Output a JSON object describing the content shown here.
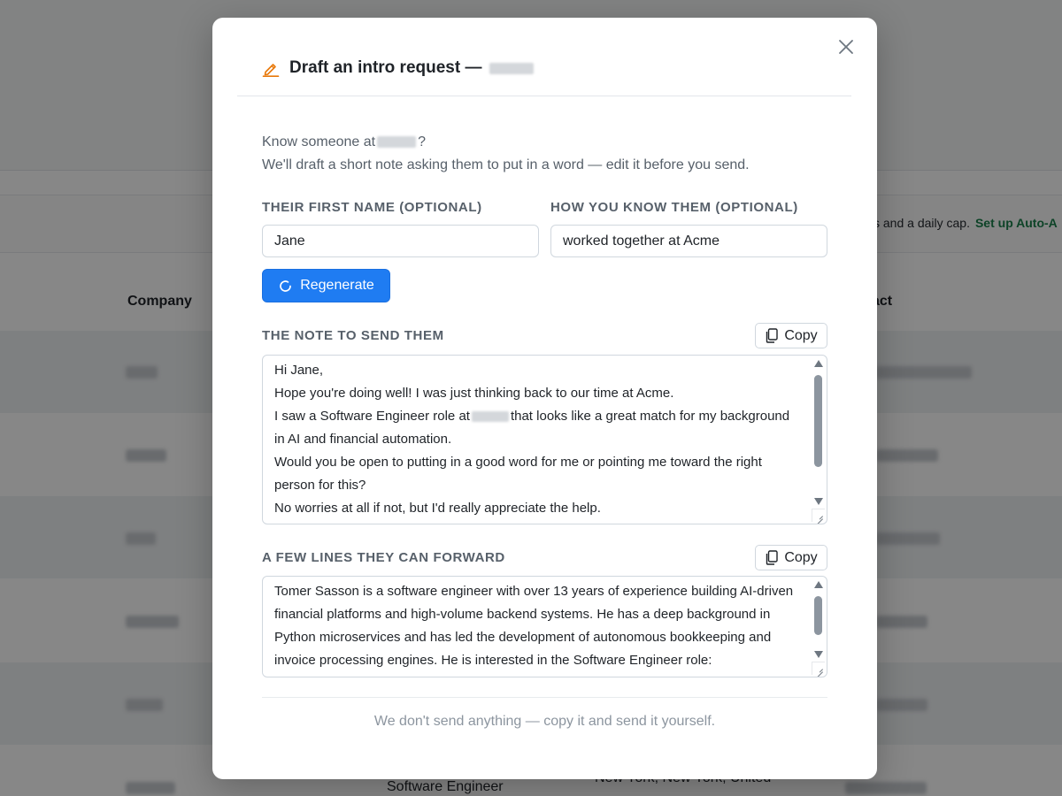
{
  "background": {
    "banner_text": "s and a daily cap.",
    "banner_link": "Set up Auto-A",
    "col_company": "Company",
    "col_contact": "act",
    "last_row_role": "Software Engineer",
    "last_row_location": "New York, New York, United"
  },
  "modal": {
    "title": "Draft an intro request —",
    "intro_line1_prefix": "Know someone at",
    "intro_line1_suffix": "?",
    "intro_line2": "We'll draft a short note asking them to put in a word — edit it before you send.",
    "first_name_label": "THEIR FIRST NAME (OPTIONAL)",
    "first_name_value": "Jane",
    "how_know_label": "HOW YOU KNOW THEM (OPTIONAL)",
    "how_know_value": "worked together at Acme",
    "regenerate_label": "Regenerate",
    "note_label": "THE NOTE TO SEND THEM",
    "copy_label": "Copy",
    "note_lines": {
      "l1": "Hi Jane,",
      "l2": "Hope you're doing well! I was just thinking back to our time at Acme.",
      "l3_prefix": "I saw a Software Engineer role at",
      "l3_suffix": "that looks like a great match for my background",
      "l4": "in AI and financial automation.",
      "l5": "Would you be open to putting in a good word for me or pointing me toward the right",
      "l6": "person for this?",
      "l7": "No worries at all if not, but I'd really appreciate the help."
    },
    "forward_label": "A FEW LINES THEY CAN FORWARD",
    "forward_lines": {
      "l1": "Tomer Sasson is a software engineer with over 13 years of experience building AI-driven",
      "l2": "financial platforms and high-volume backend systems. He has a deep background in",
      "l3": "Python microservices and has led the development of autonomous bookkeeping and",
      "l4": "invoice processing engines. He is interested in the Software Engineer role:"
    },
    "footer_text": "We don't send anything — copy it and send it yourself."
  }
}
